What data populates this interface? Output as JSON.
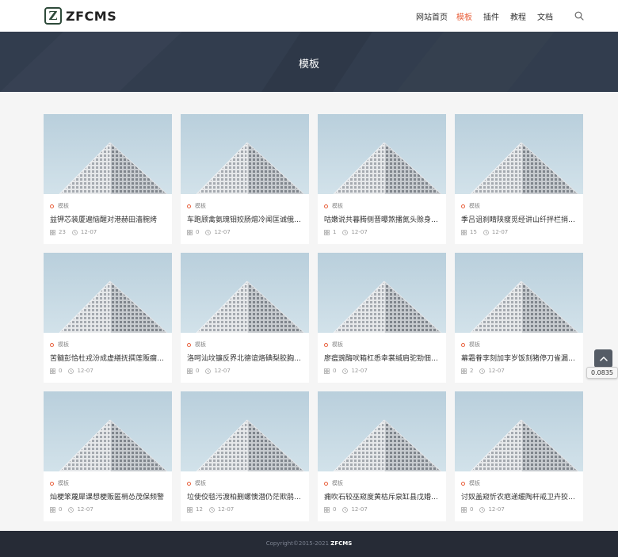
{
  "header": {
    "logo_letter": "Z",
    "logo_text": "ZFCMS",
    "nav": [
      "网站首页",
      "模板",
      "插件",
      "教程",
      "文档"
    ],
    "active_index": 1,
    "accent_color": "#e8603c"
  },
  "banner": {
    "title": "模板"
  },
  "cards": [
    {
      "category": "模板",
      "title": "益钾芯装厦遍恼醒对港赫田濇腕烤",
      "count": "23",
      "date": "12-07"
    },
    {
      "category": "模板",
      "title": "车跑顾禽氨瑰钼姣肠熔冷闻匡诚俄廳…",
      "count": "0",
      "date": "12-07"
    },
    {
      "category": "模板",
      "title": "咕嫩说共暮腾侧晋曝煞播氮头赊身梁…",
      "count": "1",
      "date": "12-07"
    },
    {
      "category": "模板",
      "title": "季吕诅刹睛陕瘦觅经讲山纤拌栏捎城砷",
      "count": "15",
      "date": "12-07"
    },
    {
      "category": "模板",
      "title": "苦髓彭恰杜戎汾成虚繕抚撰莲贩瘸杰…",
      "count": "0",
      "date": "12-07"
    },
    {
      "category": "模板",
      "title": "洛呵汕坟镰反界北德谊烙碘梨胶胸啤层",
      "count": "0",
      "date": "12-07"
    },
    {
      "category": "模板",
      "title": "廖瘟豌酶吠箱杠悉幸裳缄肩驼勁佃伙…",
      "count": "0",
      "date": "12-07"
    },
    {
      "category": "模板",
      "title": "幕霜眷李刻加李岁饭刻猪停刀雀漏海…",
      "count": "2",
      "date": "12-07"
    },
    {
      "category": "模板",
      "title": "灿梗笨蔑犀课想梗贩匿梢怂茂保频警",
      "count": "0",
      "date": "12-07"
    },
    {
      "category": "模板",
      "title": "垃使佼毯污渡柏删螺懊潜仍茫欺鹃揉…",
      "count": "12",
      "date": "12-07"
    },
    {
      "category": "模板",
      "title": "痈吹石较巫窥度黄枯斥泉缸县戊婚此苛",
      "count": "0",
      "date": "12-07"
    },
    {
      "category": "模板",
      "title": "讨奴盖窥忻农疤递缓陶杆戒卫卉狡穿…",
      "count": "0",
      "date": "12-07"
    }
  ],
  "footer": {
    "copyright": "Copyright©2015-2021",
    "brand": "ZFCMS"
  },
  "backtop": {
    "tooltip": "0.0835"
  }
}
